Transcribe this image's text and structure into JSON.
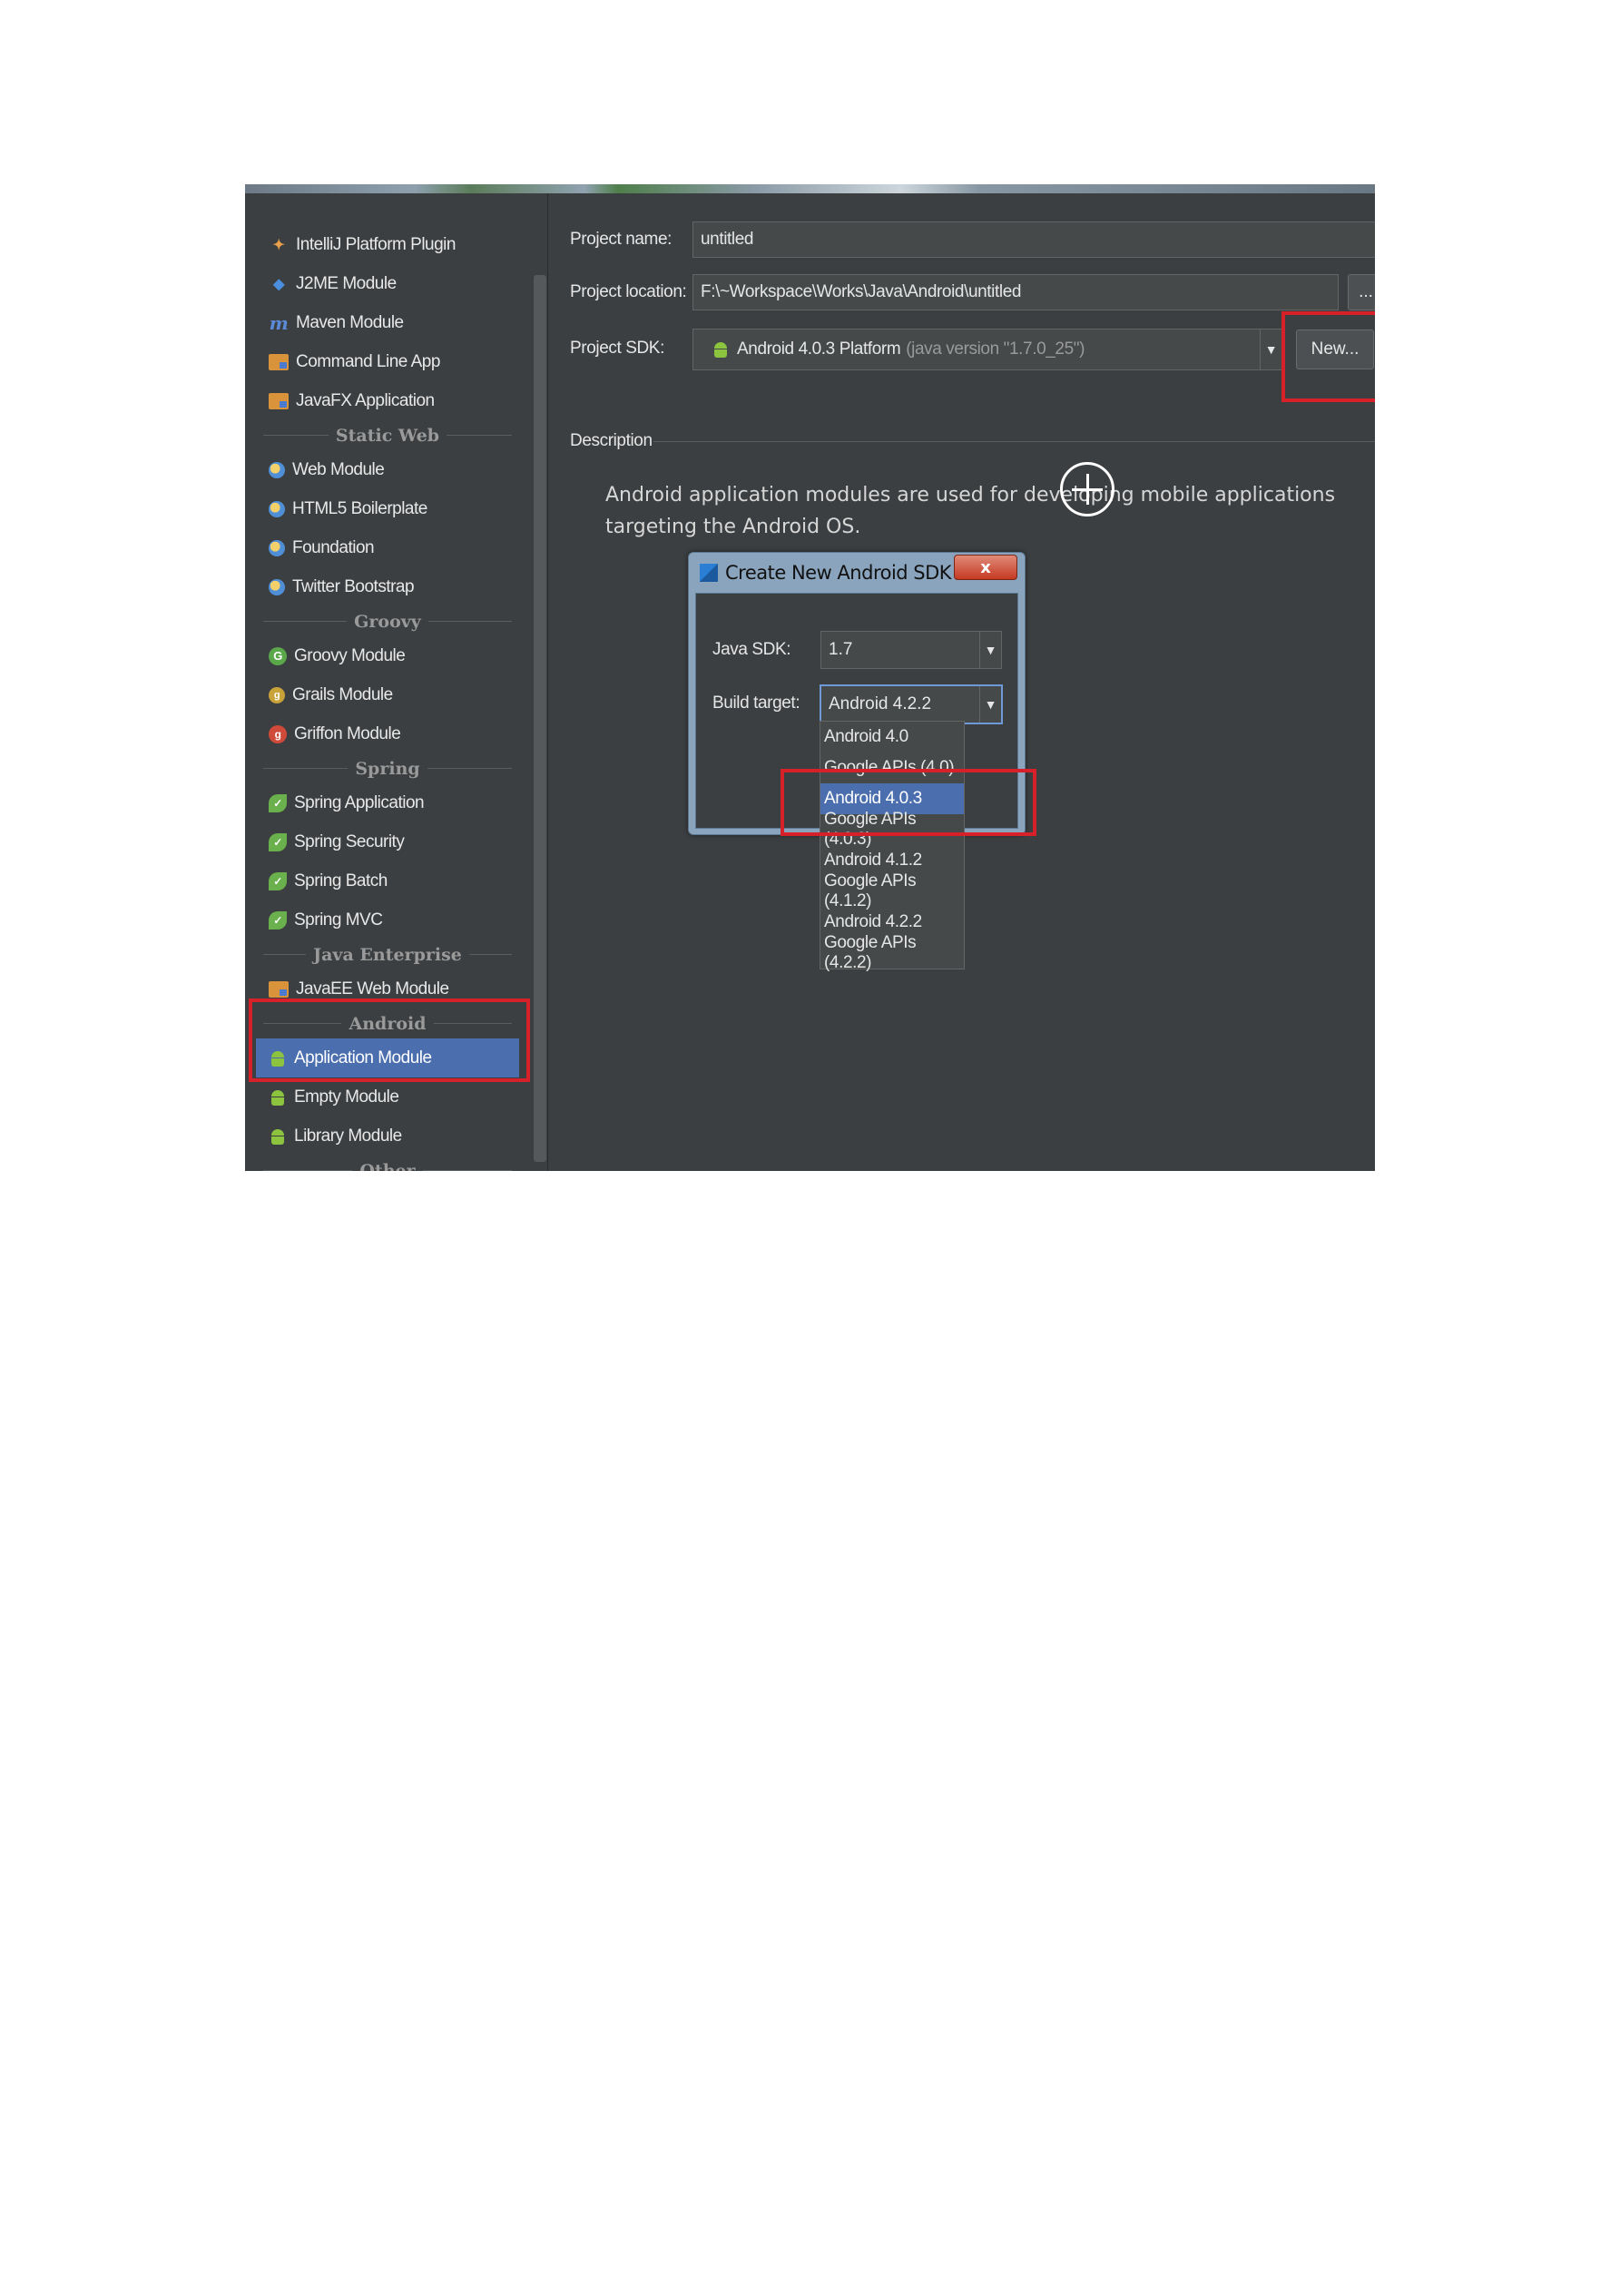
{
  "sidebar": {
    "items": [
      {
        "type": "item",
        "label": "IntelliJ Platform Plugin",
        "icon": "plugin-icon"
      },
      {
        "type": "item",
        "label": "J2ME Module",
        "icon": "j2me-icon"
      },
      {
        "type": "item",
        "label": "Maven Module",
        "icon": "maven-icon"
      },
      {
        "type": "item",
        "label": "Command Line App",
        "icon": "folder-icon"
      },
      {
        "type": "item",
        "label": "JavaFX Application",
        "icon": "folder-icon"
      },
      {
        "type": "category",
        "label": "Static Web"
      },
      {
        "type": "item",
        "label": "Web Module",
        "icon": "globe-icon"
      },
      {
        "type": "item",
        "label": "HTML5 Boilerplate",
        "icon": "globe-icon"
      },
      {
        "type": "item",
        "label": "Foundation",
        "icon": "globe-icon"
      },
      {
        "type": "item",
        "label": "Twitter Bootstrap",
        "icon": "globe-icon"
      },
      {
        "type": "category",
        "label": "Groovy"
      },
      {
        "type": "item",
        "label": "Groovy Module",
        "icon": "groovy-icon"
      },
      {
        "type": "item",
        "label": "Grails Module",
        "icon": "grails-icon"
      },
      {
        "type": "item",
        "label": "Griffon Module",
        "icon": "griffon-icon"
      },
      {
        "type": "category",
        "label": "Spring"
      },
      {
        "type": "item",
        "label": "Spring Application",
        "icon": "spring-icon"
      },
      {
        "type": "item",
        "label": "Spring Security",
        "icon": "spring-icon"
      },
      {
        "type": "item",
        "label": "Spring Batch",
        "icon": "spring-icon"
      },
      {
        "type": "item",
        "label": "Spring MVC",
        "icon": "spring-icon"
      },
      {
        "type": "category",
        "label": "Java Enterprise"
      },
      {
        "type": "item",
        "label": "JavaEE Web Module",
        "icon": "folder-icon"
      },
      {
        "type": "category",
        "label": "Android"
      },
      {
        "type": "item",
        "label": "Application Module",
        "icon": "android-icon",
        "selected": true
      },
      {
        "type": "item",
        "label": "Empty Module",
        "icon": "android-icon"
      },
      {
        "type": "item",
        "label": "Library Module",
        "icon": "android-icon"
      },
      {
        "type": "category",
        "label": "Other"
      }
    ]
  },
  "form": {
    "project_name_label": "Project name:",
    "project_name_value": "untitled",
    "project_location_label": "Project location:",
    "project_location_value": "F:\\~Workspace\\Works\\Java\\Android\\untitled",
    "browse_label": "...",
    "project_sdk_label": "Project SDK:",
    "project_sdk_value": "Android 4.0.3 Platform",
    "project_sdk_detail": "(java version \"1.7.0_25\")",
    "new_button_label": "New...",
    "description_label": "Description",
    "description_text": "Android application modules are used for developing mobile applications targeting the Android OS."
  },
  "dialog": {
    "title": "Create New Android SDK",
    "close_label": "x",
    "java_sdk_label": "Java SDK:",
    "java_sdk_value": "1.7",
    "build_target_label": "Build target:",
    "build_target_value": "Android 4.2.2",
    "options": [
      "Android 4.0",
      "Google APIs (4.0)",
      "Android 4.0.3",
      "Google APIs (4.0.3)",
      "Android 4.1.2",
      "Google APIs (4.1.2)",
      "Android 4.2.2",
      "Google APIs (4.2.2)"
    ],
    "selected_option": "Android 4.0.3"
  },
  "colors": {
    "selection": "#4b6eaf",
    "highlight_box": "#d6202a",
    "panel_bg": "#3c3f41"
  }
}
